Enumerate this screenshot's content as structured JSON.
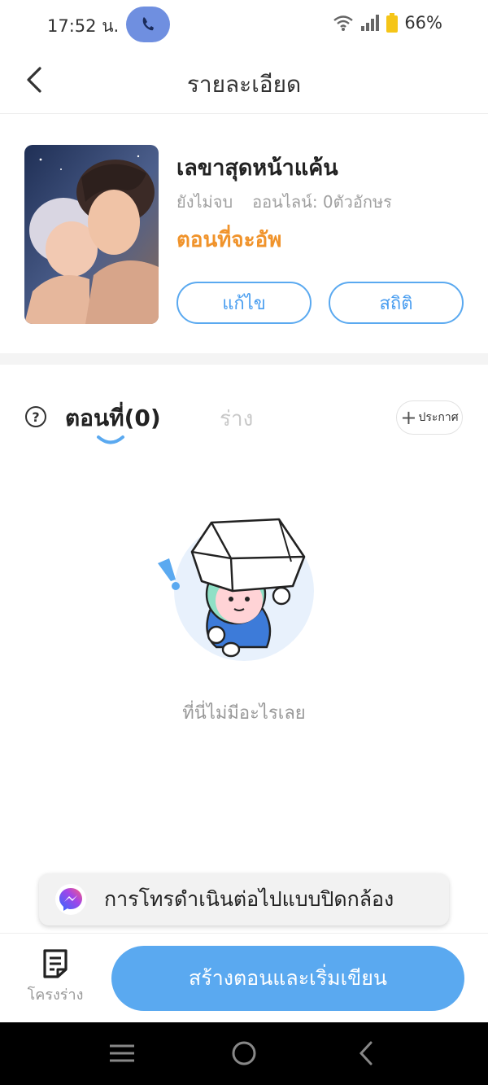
{
  "status_bar": {
    "time": "17:52 น.",
    "battery": "66%",
    "colors": {
      "pill": "#6f8fe0",
      "battery": "#f5c518"
    }
  },
  "header": {
    "title": "รายละเอียด",
    "back_icon": "chevron-left-icon"
  },
  "book": {
    "title": "เลขาสุดหน้าแค้น",
    "status": "ยังไม่จบ",
    "online_chars": "ออนไลน์: 0ตัวอักษร",
    "next_episode": "ตอนที่จะอัพ",
    "edit_label": "แก้ไข",
    "stats_label": "สถิติ"
  },
  "tabs": {
    "episodes": "ตอนที่(0)",
    "drafts": "ร่าง",
    "help_icon": "question-circle-icon",
    "announce_label": "ประกาศ"
  },
  "empty_state": {
    "message": "ที่นี่ไม่มีอะไรเลย"
  },
  "toast": {
    "text": "การโทรดำเนินต่อไปแบบปิดกล้อง",
    "icon": "messenger-icon"
  },
  "bottom_bar": {
    "outline_label": "โครงร่าง",
    "create_label": "สร้างตอนและเริ่มเขียน"
  },
  "colors": {
    "accent": "#5aa9f0",
    "orange": "#f0932b",
    "muted": "#a0a0a0"
  }
}
